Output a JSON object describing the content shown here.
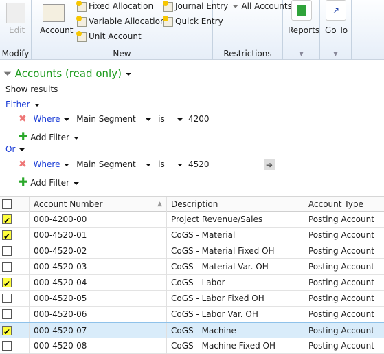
{
  "ribbon": {
    "modify": {
      "edit": "Edit",
      "label": "Modify"
    },
    "new": {
      "account": "Account",
      "fixed_allocation": "Fixed Allocation",
      "variable_allocation": "Variable Allocation",
      "unit_account": "Unit Account",
      "journal_entry": "Journal Entry",
      "quick_entry": "Quick Entry",
      "label": "New"
    },
    "restrictions": {
      "all_accounts": "All Accounts",
      "label": "Restrictions"
    },
    "reports": {
      "label": "Reports"
    },
    "goto": {
      "label": "Go To"
    }
  },
  "filter": {
    "title": "Accounts (read only)",
    "show_results": "Show results",
    "groups": [
      {
        "connector": "Either",
        "where": "Where",
        "field": "Main Segment",
        "op": "is",
        "value": "4200",
        "add": "Add Filter"
      },
      {
        "connector": "Or",
        "where": "Where",
        "field": "Main Segment",
        "op": "is",
        "value": "4520",
        "add": "Add Filter"
      }
    ]
  },
  "grid": {
    "columns": [
      "Account Number",
      "Description",
      "Account Type"
    ],
    "rows": [
      {
        "checked": true,
        "number": "000-4200-00",
        "desc": "Project Revenue/Sales",
        "type": "Posting Account"
      },
      {
        "checked": true,
        "number": "000-4520-01",
        "desc": "CoGS - Material",
        "type": "Posting Account"
      },
      {
        "checked": false,
        "number": "000-4520-02",
        "desc": "CoGS - Material Fixed OH",
        "type": "Posting Account"
      },
      {
        "checked": false,
        "number": "000-4520-03",
        "desc": "CoGS - Material Var. OH",
        "type": "Posting Account"
      },
      {
        "checked": true,
        "number": "000-4520-04",
        "desc": "CoGS - Labor",
        "type": "Posting Account"
      },
      {
        "checked": false,
        "number": "000-4520-05",
        "desc": "CoGS - Labor Fixed OH",
        "type": "Posting Account"
      },
      {
        "checked": false,
        "number": "000-4520-06",
        "desc": "CoGS - Labor Var. OH",
        "type": "Posting Account"
      },
      {
        "checked": true,
        "number": "000-4520-07",
        "desc": "CoGS - Machine",
        "type": "Posting Account",
        "selected": true
      },
      {
        "checked": false,
        "number": "000-4520-08",
        "desc": "CoGS - Machine Fixed OH",
        "type": "Posting Account"
      }
    ]
  }
}
